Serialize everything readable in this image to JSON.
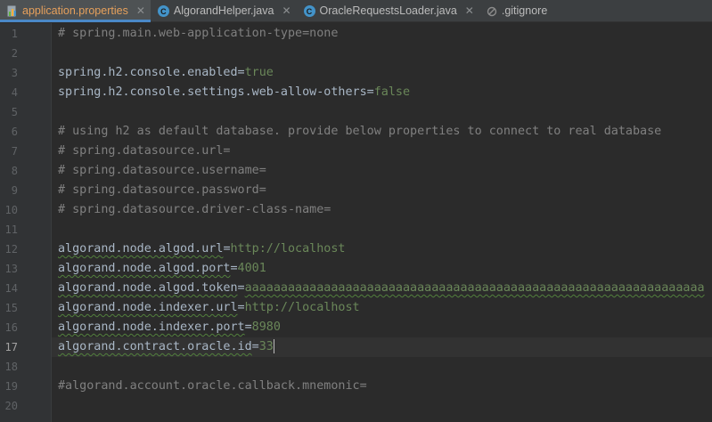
{
  "tabs": [
    {
      "label": "application.properties",
      "icon": "properties-file-icon",
      "active": true
    },
    {
      "label": "AlgorandHelper.java",
      "icon": "java-class-icon",
      "active": false
    },
    {
      "label": "OracleRequestsLoader.java",
      "icon": "java-class-icon",
      "active": false
    },
    {
      "label": ".gitignore",
      "icon": "gitignore-file-icon",
      "active": false
    }
  ],
  "tab_close_glyph": "✕",
  "editor": {
    "current_line": 17,
    "lines": [
      {
        "number": "1",
        "comment": "# spring.main.web-application-type=none"
      },
      {
        "number": "2"
      },
      {
        "number": "3",
        "key": "spring.h2.console.enabled",
        "value": "true"
      },
      {
        "number": "4",
        "key": "spring.h2.console.settings.web-allow-others",
        "value": "false"
      },
      {
        "number": "5"
      },
      {
        "number": "6",
        "comment": "# using h2 as default database. provide below properties to connect to real database"
      },
      {
        "number": "7",
        "comment": "# spring.datasource.url="
      },
      {
        "number": "8",
        "comment": "# spring.datasource.username="
      },
      {
        "number": "9",
        "comment": "# spring.datasource.password="
      },
      {
        "number": "10",
        "comment": "# spring.datasource.driver-class-name="
      },
      {
        "number": "11"
      },
      {
        "number": "12",
        "key": "algorand.node.algod.url",
        "value": "http://localhost"
      },
      {
        "number": "13",
        "key": "algorand.node.algod.port",
        "value": "4001"
      },
      {
        "number": "14",
        "key": "algorand.node.algod.token",
        "value": "aaaaaaaaaaaaaaaaaaaaaaaaaaaaaaaaaaaaaaaaaaaaaaaaaaaaaaaaaaaaaaaa"
      },
      {
        "number": "15",
        "key": "algorand.node.indexer.url",
        "value": "http://localhost"
      },
      {
        "number": "16",
        "key": "algorand.node.indexer.port",
        "value": "8980"
      },
      {
        "number": "17",
        "key": "algorand.contract.oracle.id",
        "value": "33"
      },
      {
        "number": "18"
      },
      {
        "number": "19",
        "comment": "#algorand.account.oracle.callback.mnemonic="
      },
      {
        "number": "20"
      }
    ]
  },
  "colors": {
    "background": "#2b2b2b",
    "comment": "#808080",
    "key": "#a9b7c6",
    "value": "#6a8759",
    "accent": "#4a88c7"
  }
}
